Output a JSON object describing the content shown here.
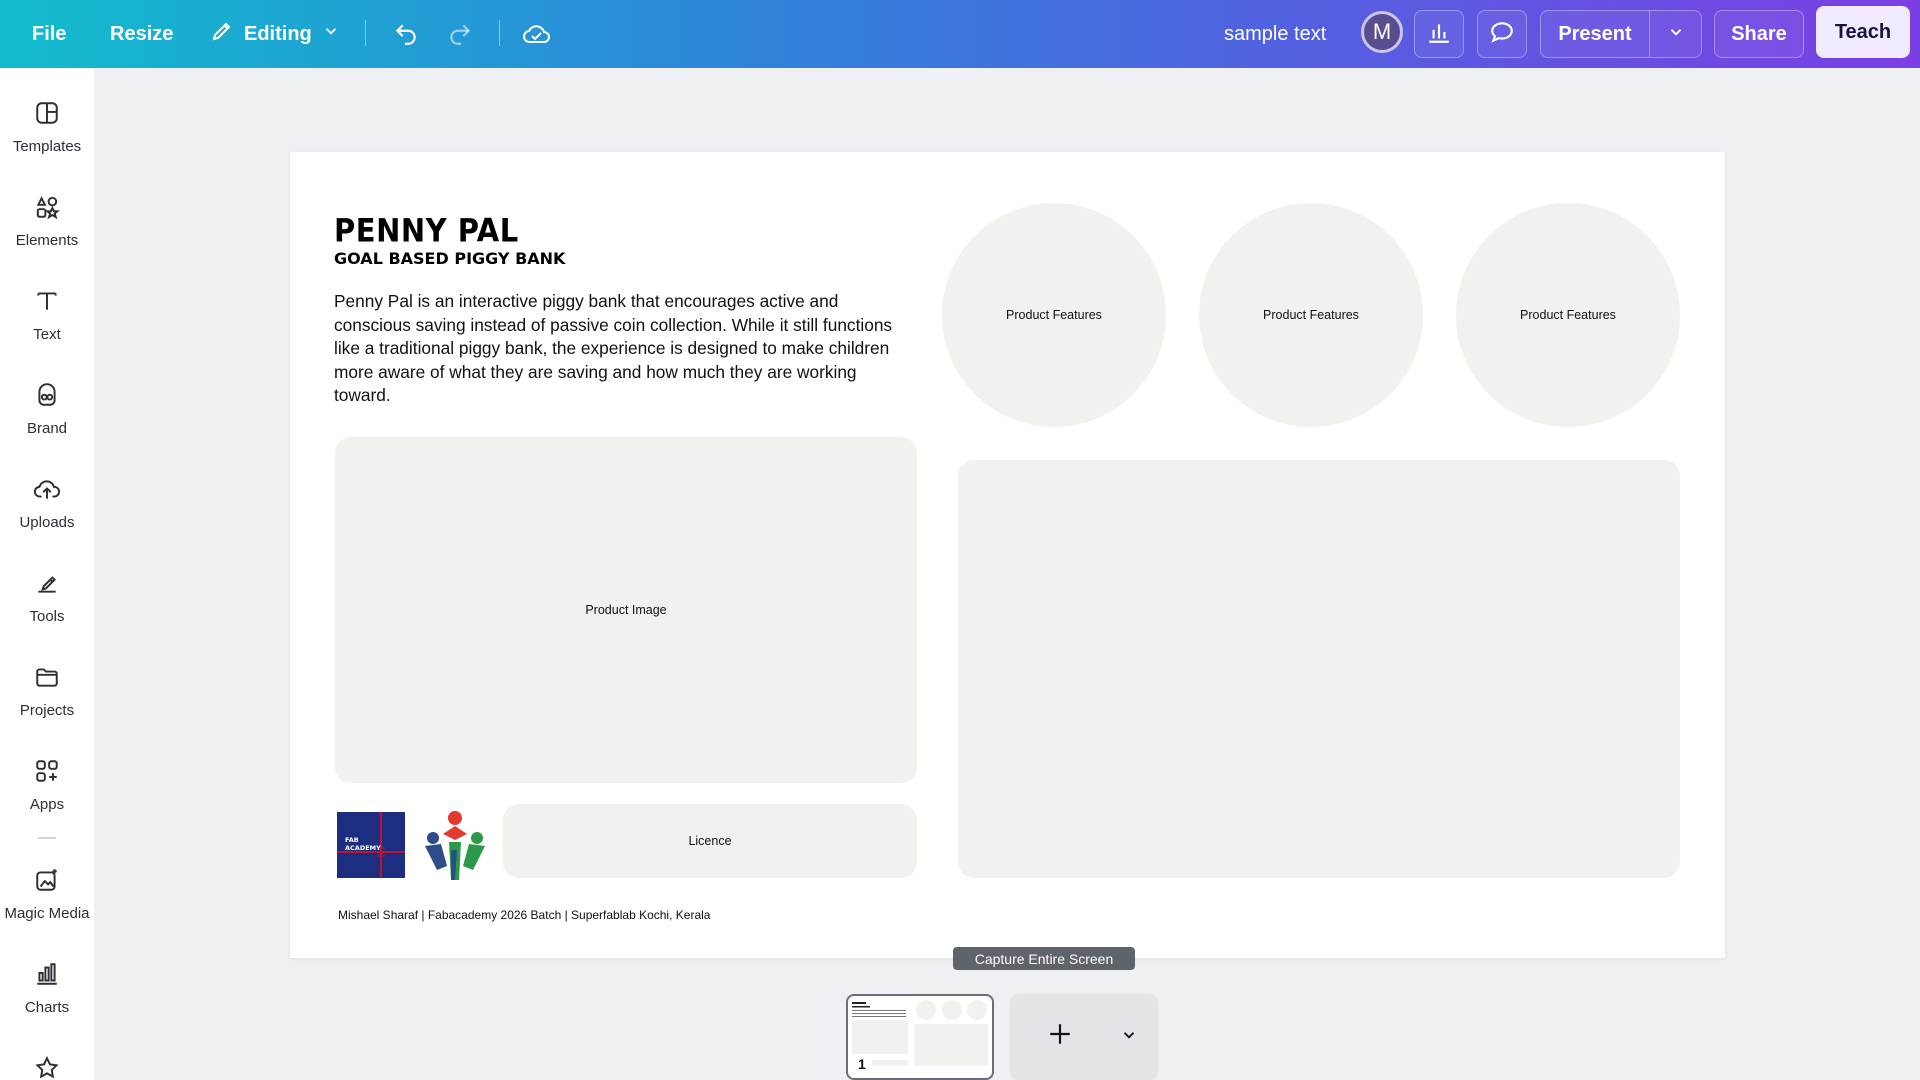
{
  "topbar": {
    "file_label": "File",
    "resize_label": "Resize",
    "editing_label": "Editing",
    "sample_text": "sample text",
    "avatar_initial": "M",
    "present_label": "Present",
    "share_label": "Share",
    "teach_label": "Teach"
  },
  "sidebar": {
    "items": [
      {
        "label": "Templates",
        "icon": "templates-icon"
      },
      {
        "label": "Elements",
        "icon": "elements-icon"
      },
      {
        "label": "Text",
        "icon": "text-icon"
      },
      {
        "label": "Brand",
        "icon": "brand-icon"
      },
      {
        "label": "Uploads",
        "icon": "uploads-icon"
      },
      {
        "label": "Tools",
        "icon": "tools-icon"
      },
      {
        "label": "Projects",
        "icon": "projects-icon"
      },
      {
        "label": "Apps",
        "icon": "apps-icon"
      },
      {
        "label": "Magic Media",
        "icon": "magic-media-icon"
      },
      {
        "label": "Charts",
        "icon": "charts-icon"
      },
      {
        "label": "",
        "icon": "star-icon"
      }
    ]
  },
  "page": {
    "title": "PENNY PAL",
    "subtitle": "GOAL BASED PIGGY BANK",
    "description": "Penny Pal is an interactive piggy bank that encourages active and conscious saving instead of passive coin collection. While it still functions like a traditional piggy bank, the experience is designed to make children more aware of what they are saving and how much they are working toward.",
    "features": [
      "Product Features",
      "Product Features",
      "Product Features"
    ],
    "product_image_label": "Product Image",
    "licence_label": "Licence",
    "fab_logo_text": "FAB ACADEMY",
    "footer": "Mishael Sharaf | Fabacademy 2026 Batch | Superfablab Kochi, Kerala"
  },
  "bottom": {
    "tooltip": "Capture Entire Screen",
    "page_number": "1"
  },
  "colors": {
    "topbar_start": "#12bccd",
    "topbar_end": "#7b3fe4",
    "placeholder": "#f1f1ed",
    "teach_bg": "#f2ebff"
  }
}
